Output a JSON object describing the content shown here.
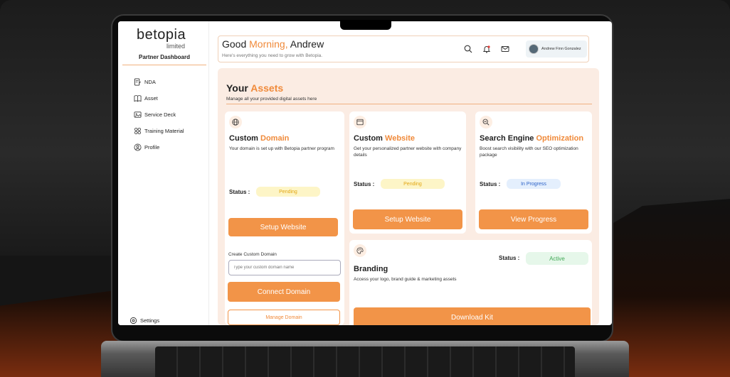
{
  "sidebar": {
    "logo": "betopia",
    "logo_sub": "limited",
    "section": "Partner Dashboard",
    "items": [
      {
        "label": "NDA",
        "icon": "document-edit-icon"
      },
      {
        "label": "Asset",
        "icon": "book-icon"
      },
      {
        "label": "Service Deck",
        "icon": "image-deck-icon"
      },
      {
        "label": "Training Material",
        "icon": "grid-icon"
      },
      {
        "label": "Profile",
        "icon": "user-circle-icon"
      }
    ],
    "settings_label": "Settings"
  },
  "header": {
    "greeting": "Good",
    "greeting_highlight": "Morning,",
    "name": "Andrew",
    "subtitle": "Here's everything you need to grow with Betopia.",
    "user_name": "Andrew Finn Gonzalez"
  },
  "assets": {
    "title": "Your",
    "title_highlight": "Assets",
    "subtitle": "Manage all your provided digital assets here",
    "status_label": "Status :",
    "cards": {
      "domain": {
        "title": "Custom",
        "title_highlight": "Domain",
        "desc": "Your domain is set up with Betopia partner program",
        "status": "Pending",
        "button": "Setup Website",
        "create_label": "Create Custom Domain",
        "input_placeholder": "Type your custom domain name",
        "connect_button": "Connect Domain",
        "manage_button": "Manage Domain"
      },
      "website": {
        "title": "Custom",
        "title_highlight": "Website",
        "desc": "Get your personalized partner website with company details",
        "status": "Pending",
        "button": "Setup Website"
      },
      "seo": {
        "title": "Search Engine",
        "title_highlight": "Optimization",
        "desc": "Boost search visibility with our SEO optimization package",
        "status": "In Progress",
        "button": "View Progress"
      },
      "branding": {
        "title": "Branding",
        "desc": "Access your logo, brand guide & marketing assets",
        "status": "Active",
        "button": "Download Kit"
      }
    }
  },
  "colors": {
    "accent": "#f29448",
    "pending": "#e2a612",
    "progress": "#2c62c7",
    "active": "#41a856"
  }
}
